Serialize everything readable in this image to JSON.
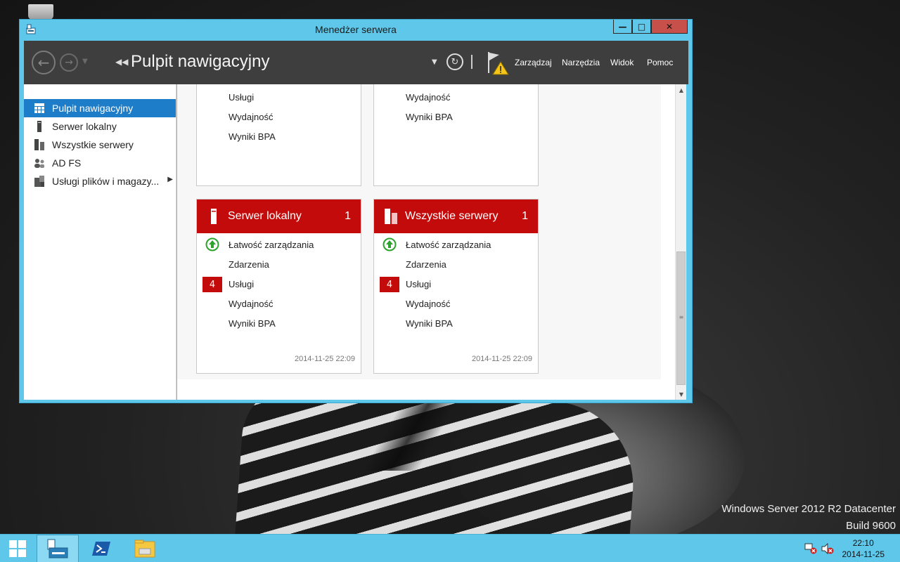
{
  "window": {
    "title": "Menedżer serwera"
  },
  "toolbar": {
    "breadcrumb": "Pulpit nawigacyjny",
    "menu": [
      "Zarządzaj",
      "Narzędzia",
      "Widok",
      "Pomoc"
    ]
  },
  "sidebar": {
    "items": [
      {
        "label": "Pulpit nawigacyjny",
        "icon": "dashboard-icon",
        "active": true
      },
      {
        "label": "Serwer lokalny",
        "icon": "server-icon",
        "active": false
      },
      {
        "label": "Wszystkie serwery",
        "icon": "servers-icon",
        "active": false
      },
      {
        "label": "AD FS",
        "icon": "adfs-icon",
        "active": false
      },
      {
        "label": "Usługi plików i magazy...",
        "icon": "file-services-icon",
        "active": false
      }
    ]
  },
  "tiles_top": [
    {
      "rows": [
        "Usługi",
        "Wydajność",
        "Wyniki BPA"
      ]
    },
    {
      "rows": [
        "Wydajność",
        "Wyniki BPA"
      ]
    }
  ],
  "tiles": [
    {
      "title": "Serwer lokalny",
      "count": "1",
      "rows": [
        "Łatwość zarządzania",
        "Zdarzenia",
        "Usługi",
        "Wydajność",
        "Wyniki BPA"
      ],
      "badge": "4",
      "timestamp": "2014-11-25 22:09"
    },
    {
      "title": "Wszystkie serwery",
      "count": "1",
      "rows": [
        "Łatwość zarządzania",
        "Zdarzenia",
        "Usługi",
        "Wydajność",
        "Wyniki BPA"
      ],
      "badge": "4",
      "timestamp": "2014-11-25 22:09"
    }
  ],
  "desktop": {
    "watermark_line1": "Windows Server 2012 R2 Datacenter",
    "watermark_line2": "Build 9600"
  },
  "clock": {
    "time": "22:10",
    "date": "2014-11-25"
  },
  "colors": {
    "accent": "#5ec7ea",
    "tile_red": "#c30b0b",
    "selection": "#1e7dc8",
    "toolbar": "#3e3e3e"
  }
}
